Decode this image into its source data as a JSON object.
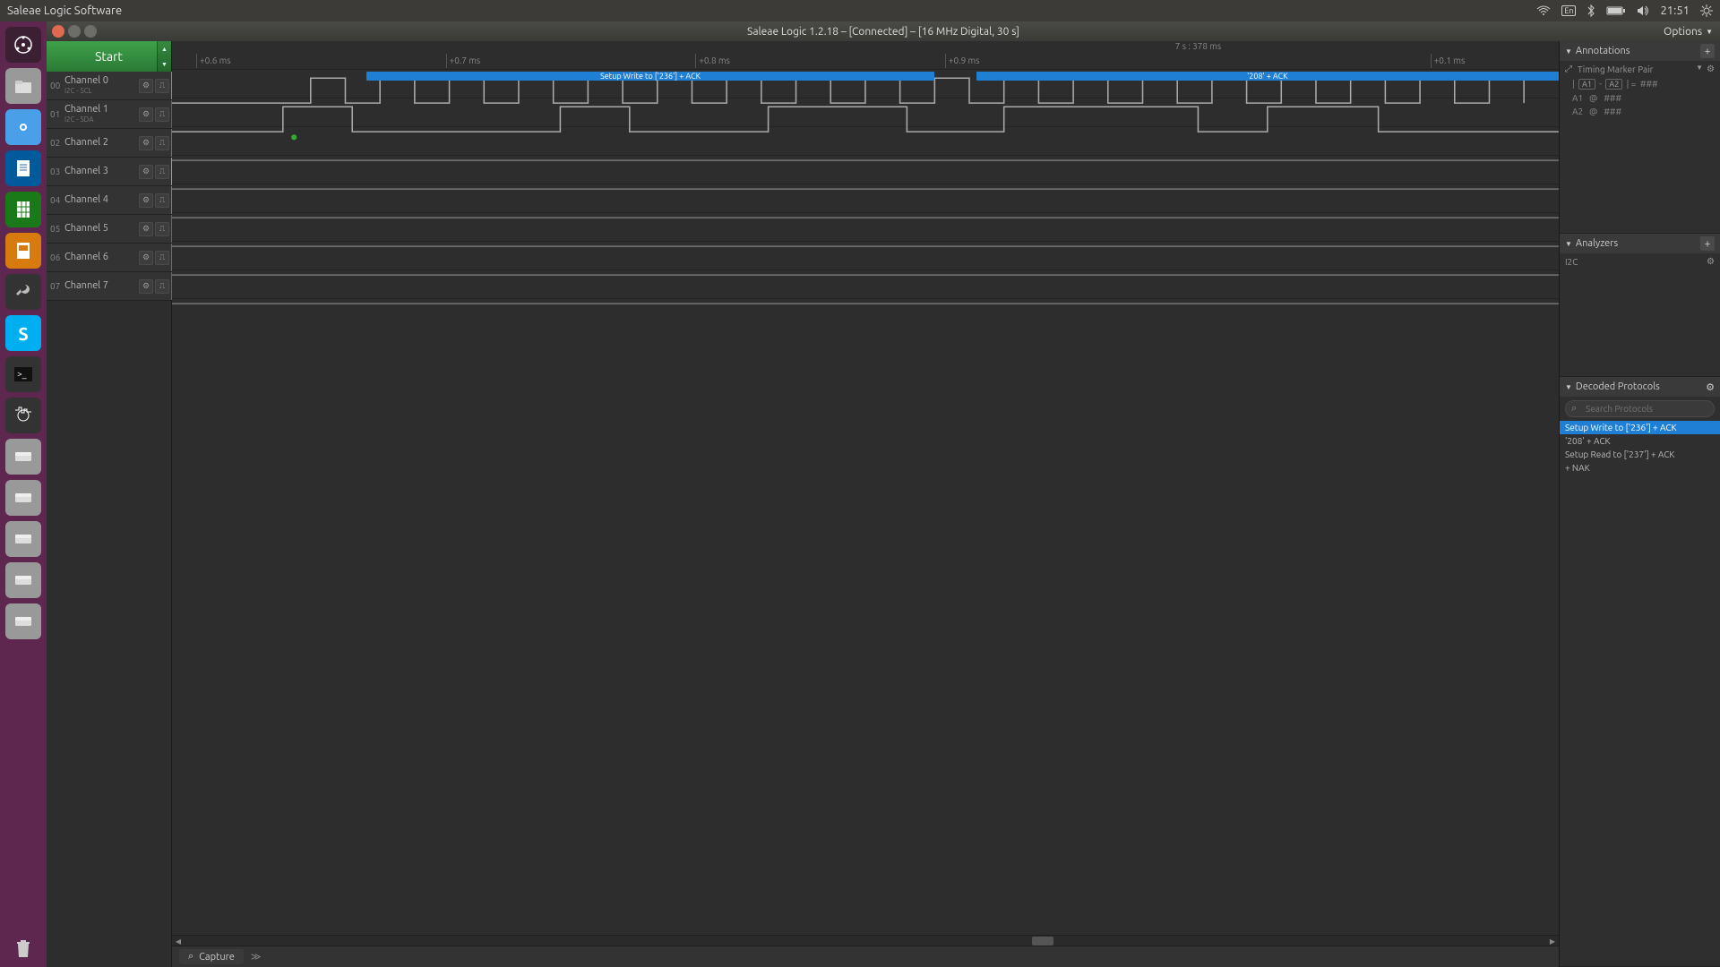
{
  "menubar": {
    "app_title": "Saleae Logic Software",
    "lang": "En",
    "time": "21:51"
  },
  "window": {
    "title": "Saleae Logic 1.2.18 – [Connected] – [16 MHz Digital, 30 s]",
    "options_label": "Options"
  },
  "start": {
    "label": "Start"
  },
  "channels": [
    {
      "num": "00",
      "name": "Channel 0",
      "sub": "I2C - SCL",
      "color": "#8c8c8c"
    },
    {
      "num": "01",
      "name": "Channel 1",
      "sub": "I2C - SDA",
      "color": "#c0392b"
    },
    {
      "num": "02",
      "name": "Channel 2",
      "sub": "",
      "color": "#d35400"
    },
    {
      "num": "03",
      "name": "Channel 3",
      "sub": "",
      "color": "#c9a400"
    },
    {
      "num": "04",
      "name": "Channel 4",
      "sub": "",
      "color": "#27ae60"
    },
    {
      "num": "05",
      "name": "Channel 5",
      "sub": "",
      "color": "#168f5a"
    },
    {
      "num": "06",
      "name": "Channel 6",
      "sub": "",
      "color": "#2980b9"
    },
    {
      "num": "07",
      "name": "Channel 7",
      "sub": "",
      "color": "#8e44ad"
    }
  ],
  "timeline": {
    "cursor_text": "7 s : 378 ms",
    "labels": [
      "+0.6 ms",
      "+0.7 ms",
      "+0.8 ms",
      "+0.9 ms",
      "+0.1 ms"
    ]
  },
  "protocol_bubbles": [
    {
      "text": "Setup Write to ['236'] + ACK"
    },
    {
      "text": "'208' + ACK"
    }
  ],
  "annotations": {
    "title": "Annotations",
    "marker_pair_label": "Timing Marker Pair",
    "expr": {
      "a1": "A1",
      "a2": "A2",
      "sep": "-",
      "eq": "=",
      "val": "###"
    },
    "rows": [
      {
        "label": "A1",
        "at": "@",
        "val": "###"
      },
      {
        "label": "A2",
        "at": "@",
        "val": "###"
      }
    ]
  },
  "analyzers": {
    "title": "Analyzers",
    "items": [
      {
        "name": "I2C"
      }
    ]
  },
  "decoded": {
    "title": "Decoded Protocols",
    "search_placeholder": "Search Protocols",
    "items": [
      {
        "text": "Setup Write to ['236'] + ACK",
        "selected": true
      },
      {
        "text": "'208' + ACK",
        "selected": false
      },
      {
        "text": "Setup Read to ['237'] + ACK",
        "selected": false
      },
      {
        "text": "  + NAK",
        "selected": false
      }
    ]
  },
  "bottom": {
    "capture_label": "Capture"
  }
}
